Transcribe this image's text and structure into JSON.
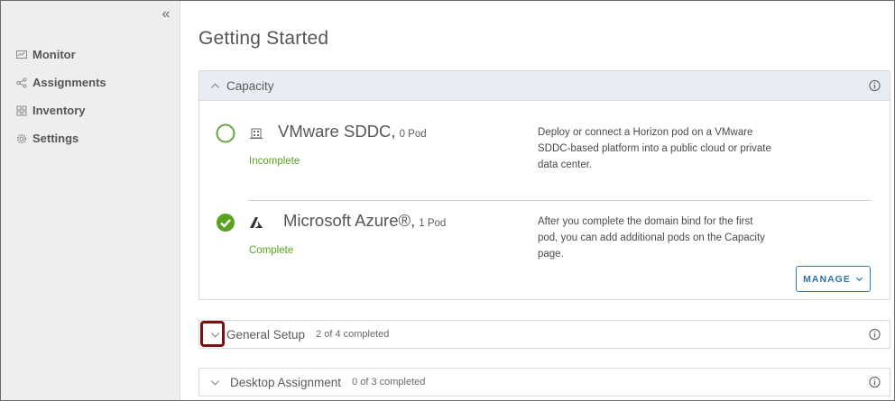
{
  "sidebar": {
    "collapse_glyph": "«",
    "items": [
      {
        "label": "Monitor",
        "icon": "monitor-icon"
      },
      {
        "label": "Assignments",
        "icon": "share-icon"
      },
      {
        "label": "Inventory",
        "icon": "grid-icon"
      },
      {
        "label": "Settings",
        "icon": "gear-icon"
      }
    ]
  },
  "main": {
    "title": "Getting Started",
    "capacity": {
      "title": "Capacity",
      "platforms": [
        {
          "name": "VMware SDDC,",
          "count": "0 Pod",
          "status": "Incomplete",
          "complete": false,
          "icon": "building-icon",
          "description": "Deploy or connect a Horizon pod on a VMware SDDC-based platform into a public cloud or private data center."
        },
        {
          "name": "Microsoft Azure®,",
          "count": "1 Pod",
          "status": "Complete",
          "complete": true,
          "icon": "azure-icon",
          "description": "After you complete the domain bind for the first pod, you can add additional pods on the Capacity page."
        }
      ],
      "manage_label": "MANAGE"
    },
    "general_setup": {
      "title": "General Setup",
      "progress": "2 of 4 completed"
    },
    "desktop_assignment": {
      "title": "Desktop Assignment",
      "progress": "0 of 3 completed"
    }
  },
  "colors": {
    "complete_green": "#5aa220",
    "accent_blue": "#2a74ad",
    "highlight_red": "#7a1111",
    "sidebar_bg": "#eeeeee",
    "capacity_header_bg": "#e8edf3"
  }
}
